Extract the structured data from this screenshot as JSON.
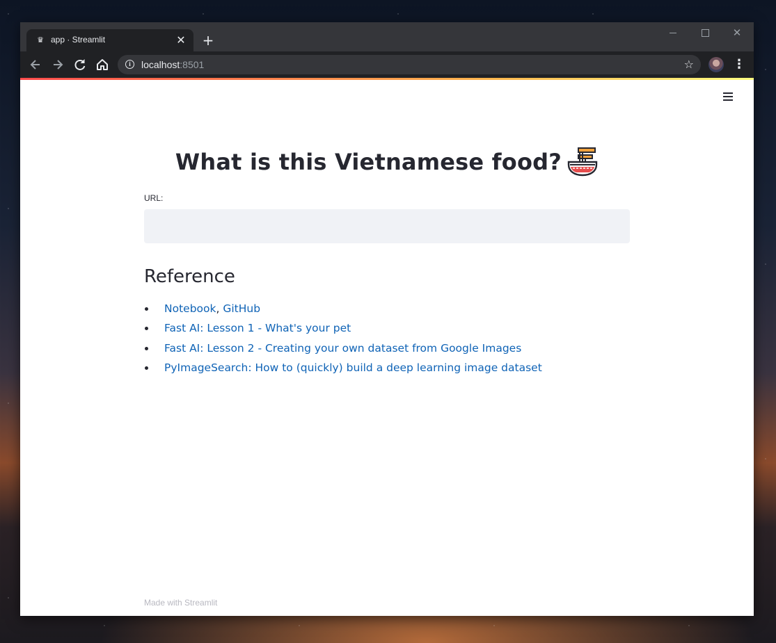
{
  "browser": {
    "tab_title": "app · Streamlit",
    "favicon": "streamlit-crown-icon",
    "new_tab_symbol": "+",
    "close_symbol": "✕",
    "url_host": "localhost",
    "url_port": ":8501"
  },
  "app": {
    "title": "What is this Vietnamese food?",
    "title_icon": "noodle-bowl-icon",
    "url_label": "URL:",
    "url_value": "",
    "url_placeholder": "",
    "reference_heading": "Reference",
    "references": [
      {
        "links": [
          "Notebook",
          "GitHub"
        ],
        "separator": ", "
      },
      {
        "links": [
          "Fast AI: Lesson 1 - What's your pet"
        ]
      },
      {
        "links": [
          "Fast AI: Lesson 2 - Creating your own dataset from Google Images"
        ]
      },
      {
        "links": [
          "PyImageSearch: How to (quickly) build a deep learning image dataset"
        ]
      }
    ],
    "footer": "Made with Streamlit"
  },
  "colors": {
    "link": "#0f63b6",
    "text": "#262730",
    "input_bg": "#f0f2f6",
    "browser_chrome": "#202124"
  }
}
